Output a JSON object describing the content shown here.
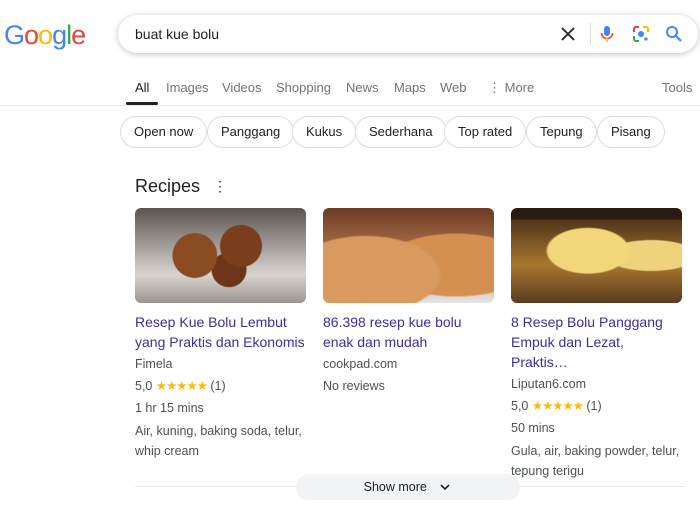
{
  "logo": "Google",
  "search": {
    "query": "buat kue bolu"
  },
  "tabs": [
    {
      "label": "All"
    },
    {
      "label": "Images"
    },
    {
      "label": "Videos"
    },
    {
      "label": "Shopping"
    },
    {
      "label": "News"
    },
    {
      "label": "Maps"
    },
    {
      "label": "Web"
    },
    {
      "label": "More"
    }
  ],
  "tools_label": "Tools",
  "chips": [
    "Open now",
    "Panggang",
    "Kukus",
    "Sederhana",
    "Top rated",
    "Tepung",
    "Pisang"
  ],
  "recipes": {
    "heading": "Recipes",
    "cards": [
      {
        "title": "Resep Kue Bolu Lembut yang Praktis dan Ekonomis",
        "source": "Fimela",
        "rating": "5,0",
        "stars": "★★★★★",
        "reviews": "(1)",
        "time": "1 hr 15 mins",
        "ingredients": "Air, kuning, baking soda, telur, whip cream"
      },
      {
        "title": "86.398 resep kue bolu enak dan mudah",
        "source": "cookpad.com",
        "no_reviews": "No reviews"
      },
      {
        "title": "8 Resep Bolu Panggang Empuk dan Lezat, Praktis…",
        "source": "Liputan6.com",
        "rating": "5,0",
        "stars": "★★★★★",
        "reviews": "(1)",
        "time": "50 mins",
        "ingredients": "Gula, air, baking powder, telur, tepung terigu"
      }
    ],
    "show_more": "Show more"
  },
  "colors": {
    "link": "#3c2f9e",
    "star": "#fbbc04"
  }
}
